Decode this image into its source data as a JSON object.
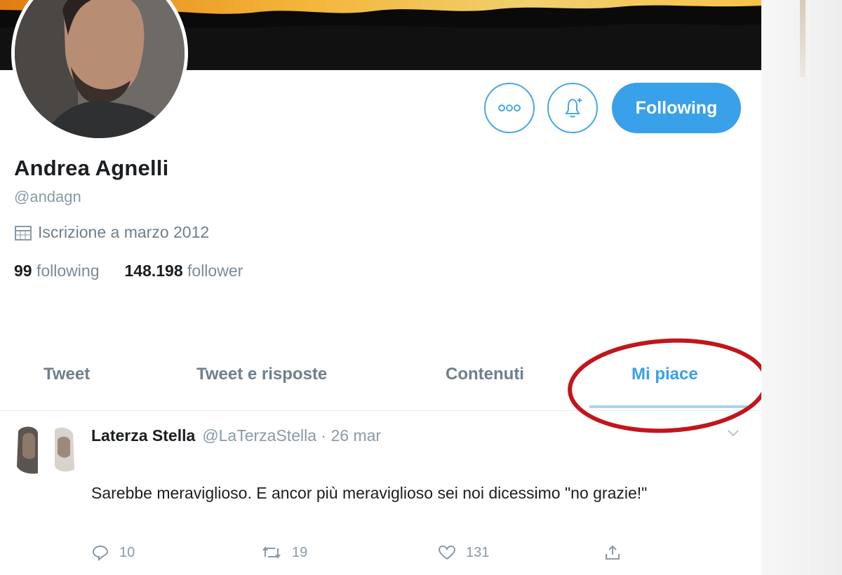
{
  "profile": {
    "name": "Andrea Agnelli",
    "handle": "@andagn",
    "joined": "Iscrizione a marzo 2012",
    "following_count": "99",
    "following_label": "following",
    "followers_count": "148.198",
    "followers_label": "follower"
  },
  "buttons": {
    "follow_label": "Following",
    "more_icon": "more-dots-icon",
    "notify_icon": "bell-plus-icon"
  },
  "tabs": [
    {
      "label": "Tweet"
    },
    {
      "label": "Tweet e risposte"
    },
    {
      "label": "Contenuti"
    },
    {
      "label": "Mi piace",
      "active": true
    }
  ],
  "tweet": {
    "author": "Laterza Stella",
    "handle": "@LaTerzaStella",
    "separator": " · ",
    "date": "26 mar",
    "text": "Sarebbe meraviglioso. E ancor più meraviglioso sei noi dicessimo \"no grazie!\"",
    "replies": "10",
    "retweets": "19",
    "likes": "131"
  },
  "colors": {
    "accent": "#39a0ea",
    "highlight_circle": "#c0161c"
  }
}
